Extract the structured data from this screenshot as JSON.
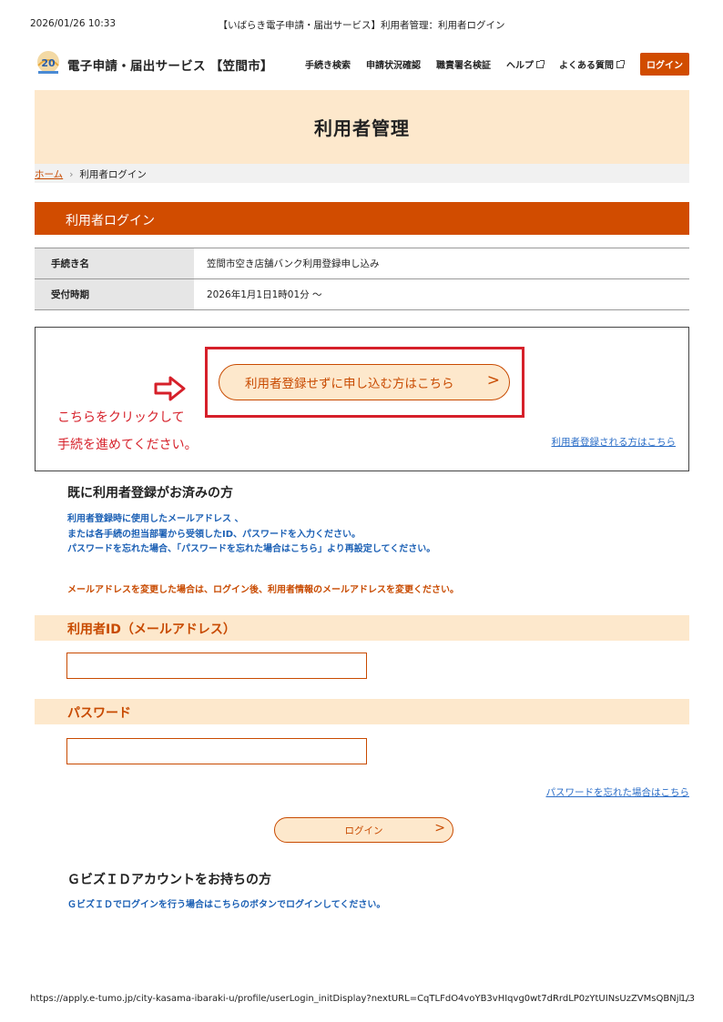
{
  "print_header": {
    "datetime": "2026/01/26 10:33",
    "title": "【いばらき電子申請・届出サービス】利用者管理：利用者ログイン"
  },
  "topbar": {
    "site_name": "電子申請・届出サービス 【笠間市】",
    "nav": [
      "手続き検索",
      "申請状況確認",
      "職責署名検証",
      "ヘルプ",
      "よくある質問"
    ],
    "login_label": "ログイン"
  },
  "hero": {
    "title": "利用者管理"
  },
  "breadcrumb": {
    "home": "ホーム",
    "current": "利用者ログイン"
  },
  "section": {
    "title": "利用者ログイン"
  },
  "procedure": {
    "rows": [
      {
        "label": "手続き名",
        "value": "笠間市空き店舗バンク利用登録申し込み"
      },
      {
        "label": "受付時期",
        "value": "2026年1月1日1時01分 〜"
      }
    ]
  },
  "notice": {
    "guest_button": "利用者登録せずに申し込む方はこちら",
    "chevron": ">",
    "annotation_line1": "こちらをクリックして",
    "annotation_line2": "手続を進めてください。",
    "register_link": "利用者登録される方はこちら",
    "highlight_color": "#d6202a"
  },
  "existing_user": {
    "heading": "既に利用者登録がお済みの方",
    "info_line1": "利用者登録時に使用したメールアドレス 、",
    "info_line2": "または各手続の担当部署から受領したID、パスワードを入力ください。",
    "info_line3": "パスワードを忘れた場合、「パスワードを忘れた場合はこちら」より再設定してください。",
    "email_change_notice": "メールアドレスを変更した場合は、ログイン後、利用者情報のメールアドレスを変更ください。"
  },
  "form": {
    "user_id_label": "利用者ID（メールアドレス）",
    "user_id_value": "",
    "password_label": "パスワード",
    "password_value": "",
    "forgot_link": "パスワードを忘れた場合はこちら",
    "submit_label": "ログイン",
    "submit_chevron": ">"
  },
  "gbiz": {
    "heading": "ＧビズＩＤアカウントをお持ちの方",
    "info": "ＧビズＩＤでログインを行う場合はこちらのボタンでログインしてください。"
  },
  "print_footer": {
    "url": "https://apply.e-tumo.jp/city-kasama-ibaraki-u/profile/userLogin_initDisplay?nextURL=CqTLFdO4voYB3vHIqvg0wt7dRrdLP0zYtUINsUzZVMsQBNjl…",
    "page": "1/3"
  },
  "colors": {
    "accent": "#d14c00",
    "band": "#fde8cc",
    "link": "#2a6dc7",
    "info_blue": "#1a5fb4"
  }
}
